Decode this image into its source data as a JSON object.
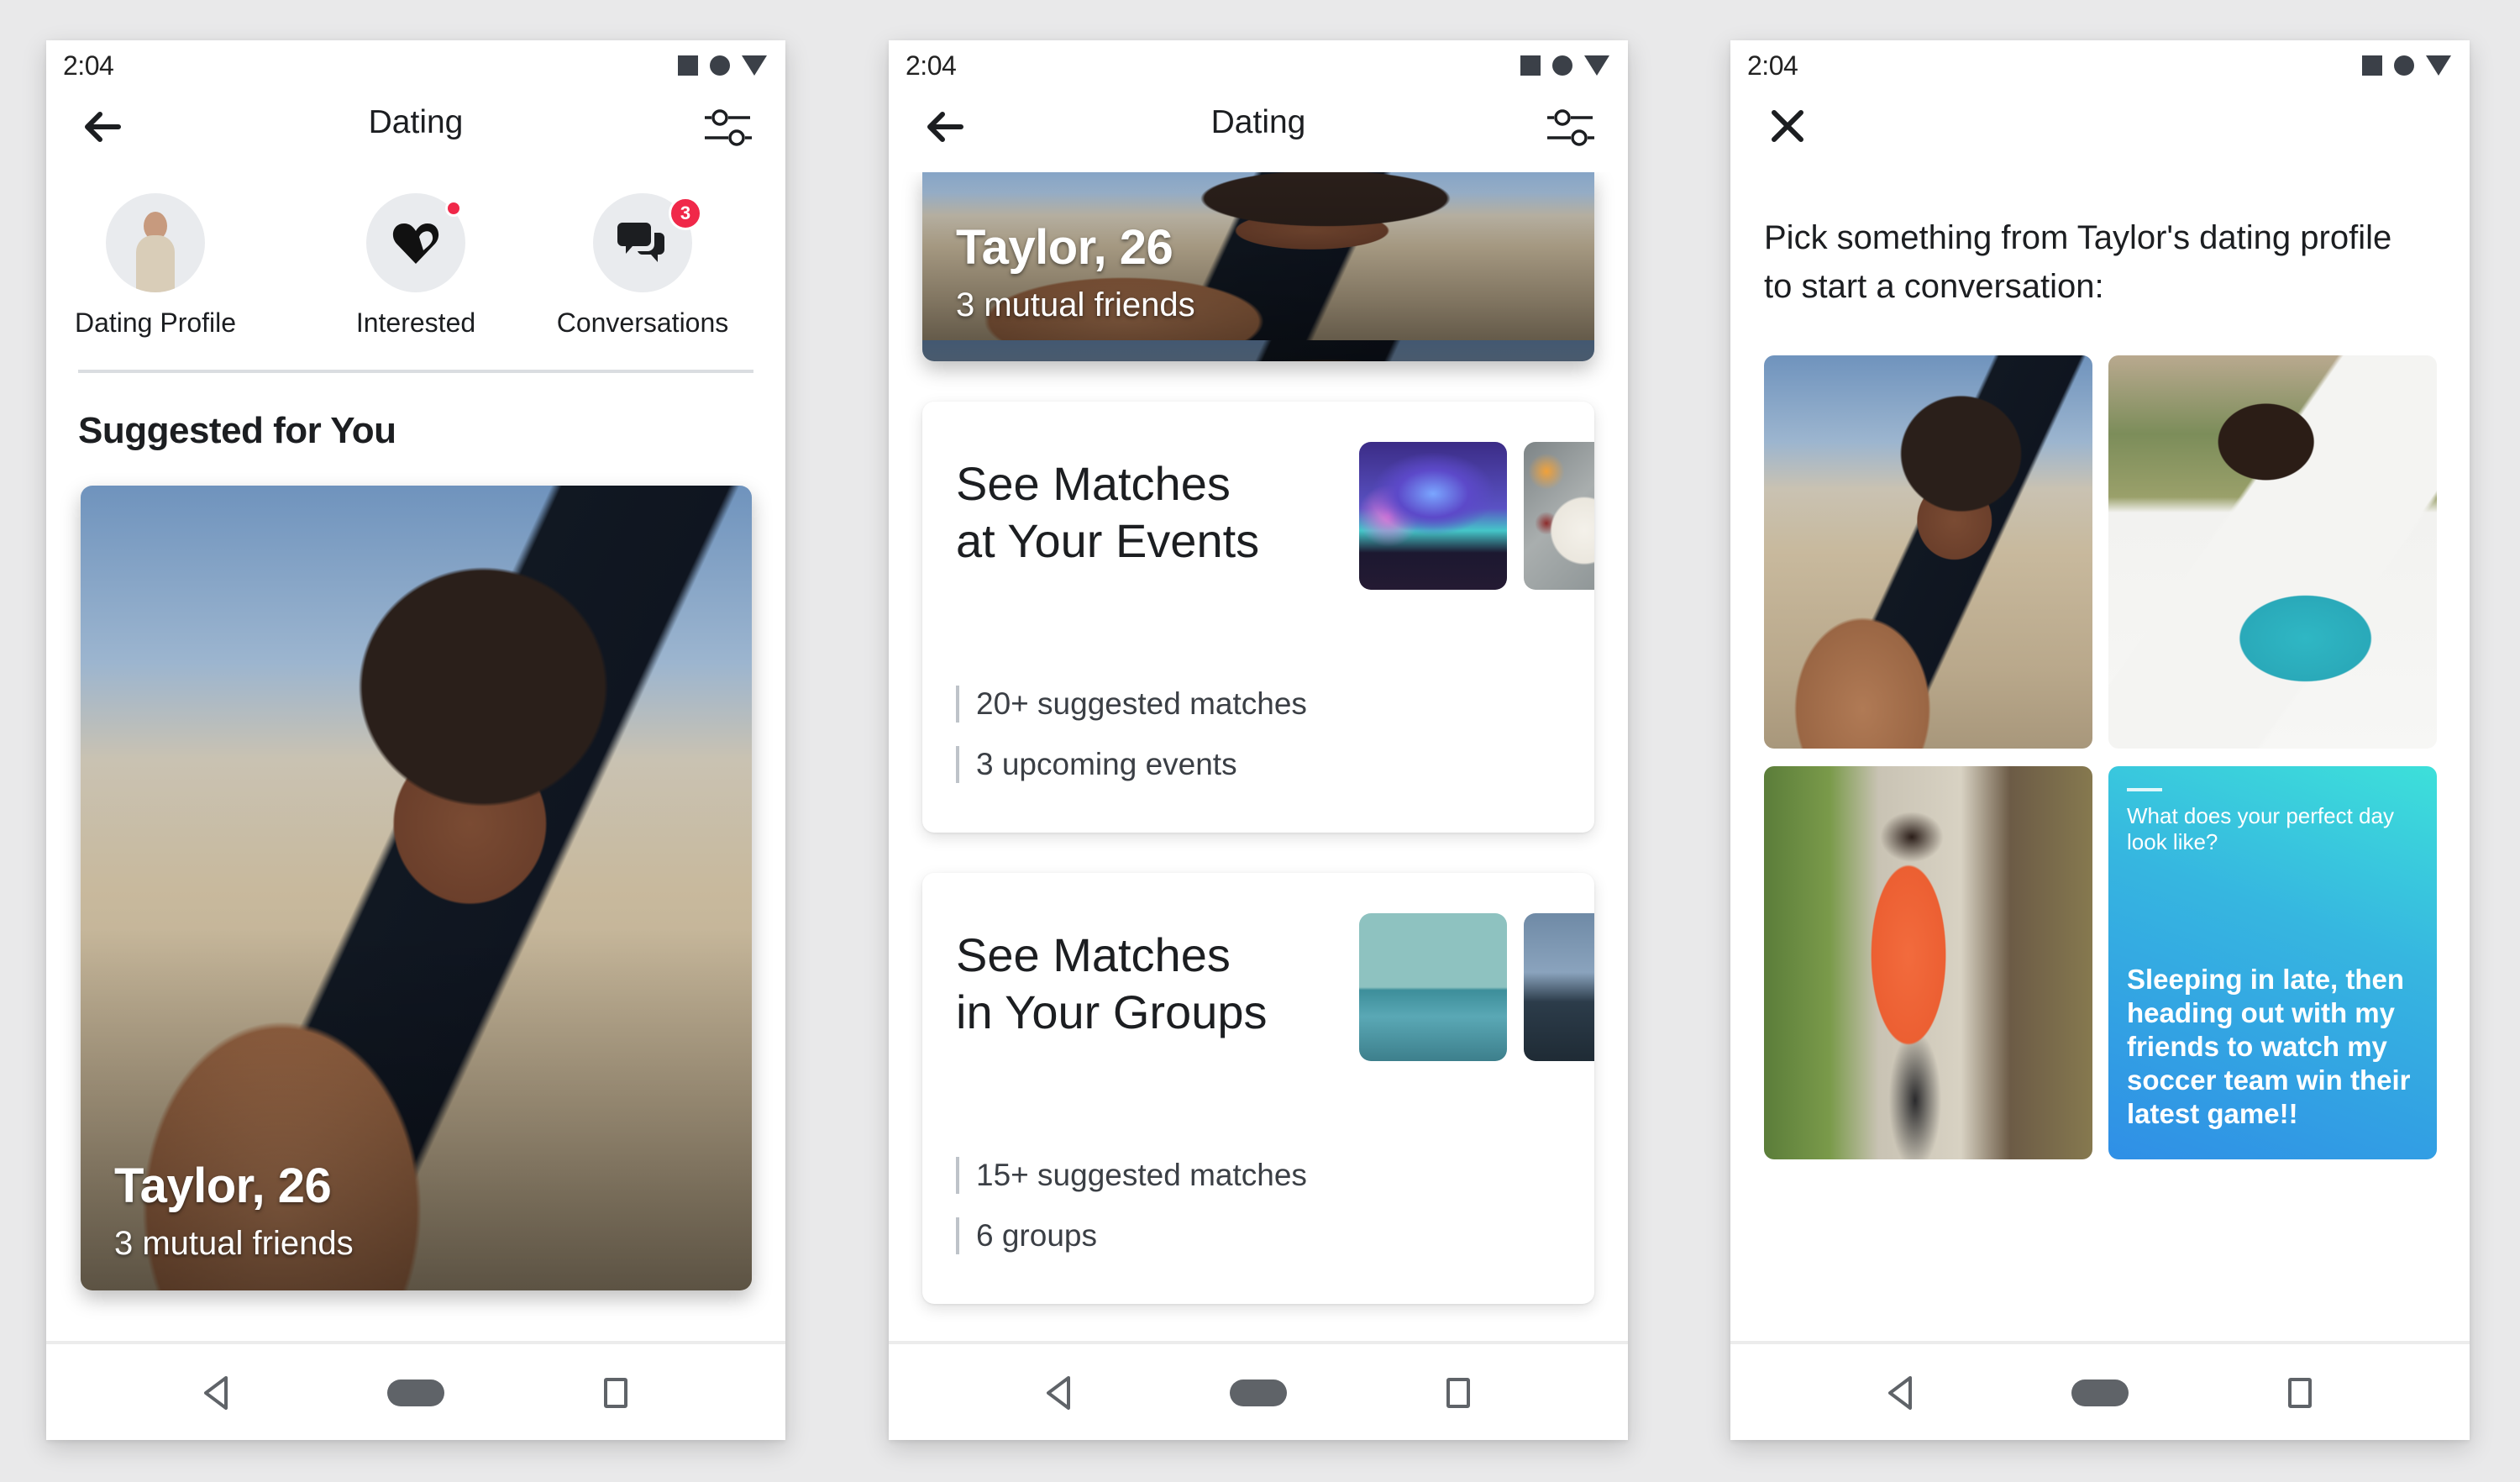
{
  "status_bar": {
    "time": "2:04"
  },
  "screen1": {
    "header": {
      "title": "Dating",
      "back_icon": "arrow-left-icon",
      "filter_icon": "sliders-icon"
    },
    "quick_actions": [
      {
        "label": "Dating Profile",
        "icon": "profile-avatar"
      },
      {
        "label": "Interested",
        "icon": "heart-icon",
        "badge": "dot"
      },
      {
        "label": "Conversations",
        "icon": "chat-bubbles-icon",
        "badge": "3"
      }
    ],
    "section_title": "Suggested for You",
    "profile_card": {
      "name": "Taylor, 26",
      "subtitle": "3 mutual friends"
    }
  },
  "screen2": {
    "header": {
      "title": "Dating"
    },
    "profile_card": {
      "name": "Taylor, 26",
      "subtitle": "3 mutual friends"
    },
    "cards": [
      {
        "title_line1": "See Matches",
        "title_line2": "at Your Events",
        "stats": [
          "20+ suggested matches",
          "3 upcoming events"
        ]
      },
      {
        "title_line1": "See Matches",
        "title_line2": "in Your Groups",
        "stats": [
          "15+ suggested matches",
          "6 groups"
        ]
      }
    ]
  },
  "screen3": {
    "close_icon": "close-icon",
    "prompt": "Pick something from Taylor's dating profile to start a conversation:",
    "prompt_card": {
      "question": "What does your perfect day look like?",
      "answer": "Sleeping in late, then heading out with my friends to watch my soccer team win their latest game!!"
    }
  },
  "colors": {
    "badge": "#f02849",
    "prompt_gradient_start": "#3de0da",
    "prompt_gradient_end": "#2f8fe6"
  }
}
